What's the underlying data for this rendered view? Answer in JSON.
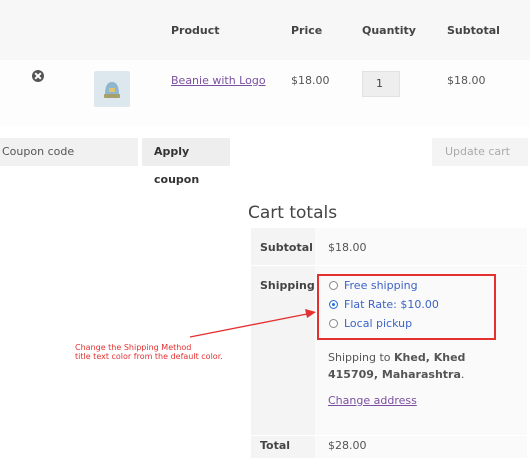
{
  "cart": {
    "headers": {
      "product": "Product",
      "price": "Price",
      "quantity": "Quantity",
      "subtotal": "Subtotal"
    },
    "item": {
      "name": "Beanie with Logo",
      "price": "$18.00",
      "quantity": "1",
      "subtotal": "$18.00",
      "thumb_icon": "beanie-product-image"
    },
    "remove_icon": "remove-circle-icon"
  },
  "coupon": {
    "placeholder": "Coupon code",
    "apply_label": "Apply coupon",
    "update_label": "Update cart"
  },
  "totals": {
    "title": "Cart totals",
    "subtotal_label": "Subtotal",
    "subtotal_value": "$18.00",
    "shipping_label": "Shipping",
    "options": [
      {
        "label": "Free shipping",
        "checked": false
      },
      {
        "label": "Flat Rate: $10.00",
        "checked": true
      },
      {
        "label": "Local pickup",
        "checked": false
      }
    ],
    "shipping_to_prefix": "Shipping to",
    "shipping_to_address": "Khed, Khed 415709, Maharashtra",
    "change_address": "Change address",
    "total_label": "Total",
    "total_value": "$28.00"
  },
  "annotation": {
    "line1": "Change the Shipping Method",
    "line2": "title text color from the default color.",
    "color": "#e53030"
  }
}
